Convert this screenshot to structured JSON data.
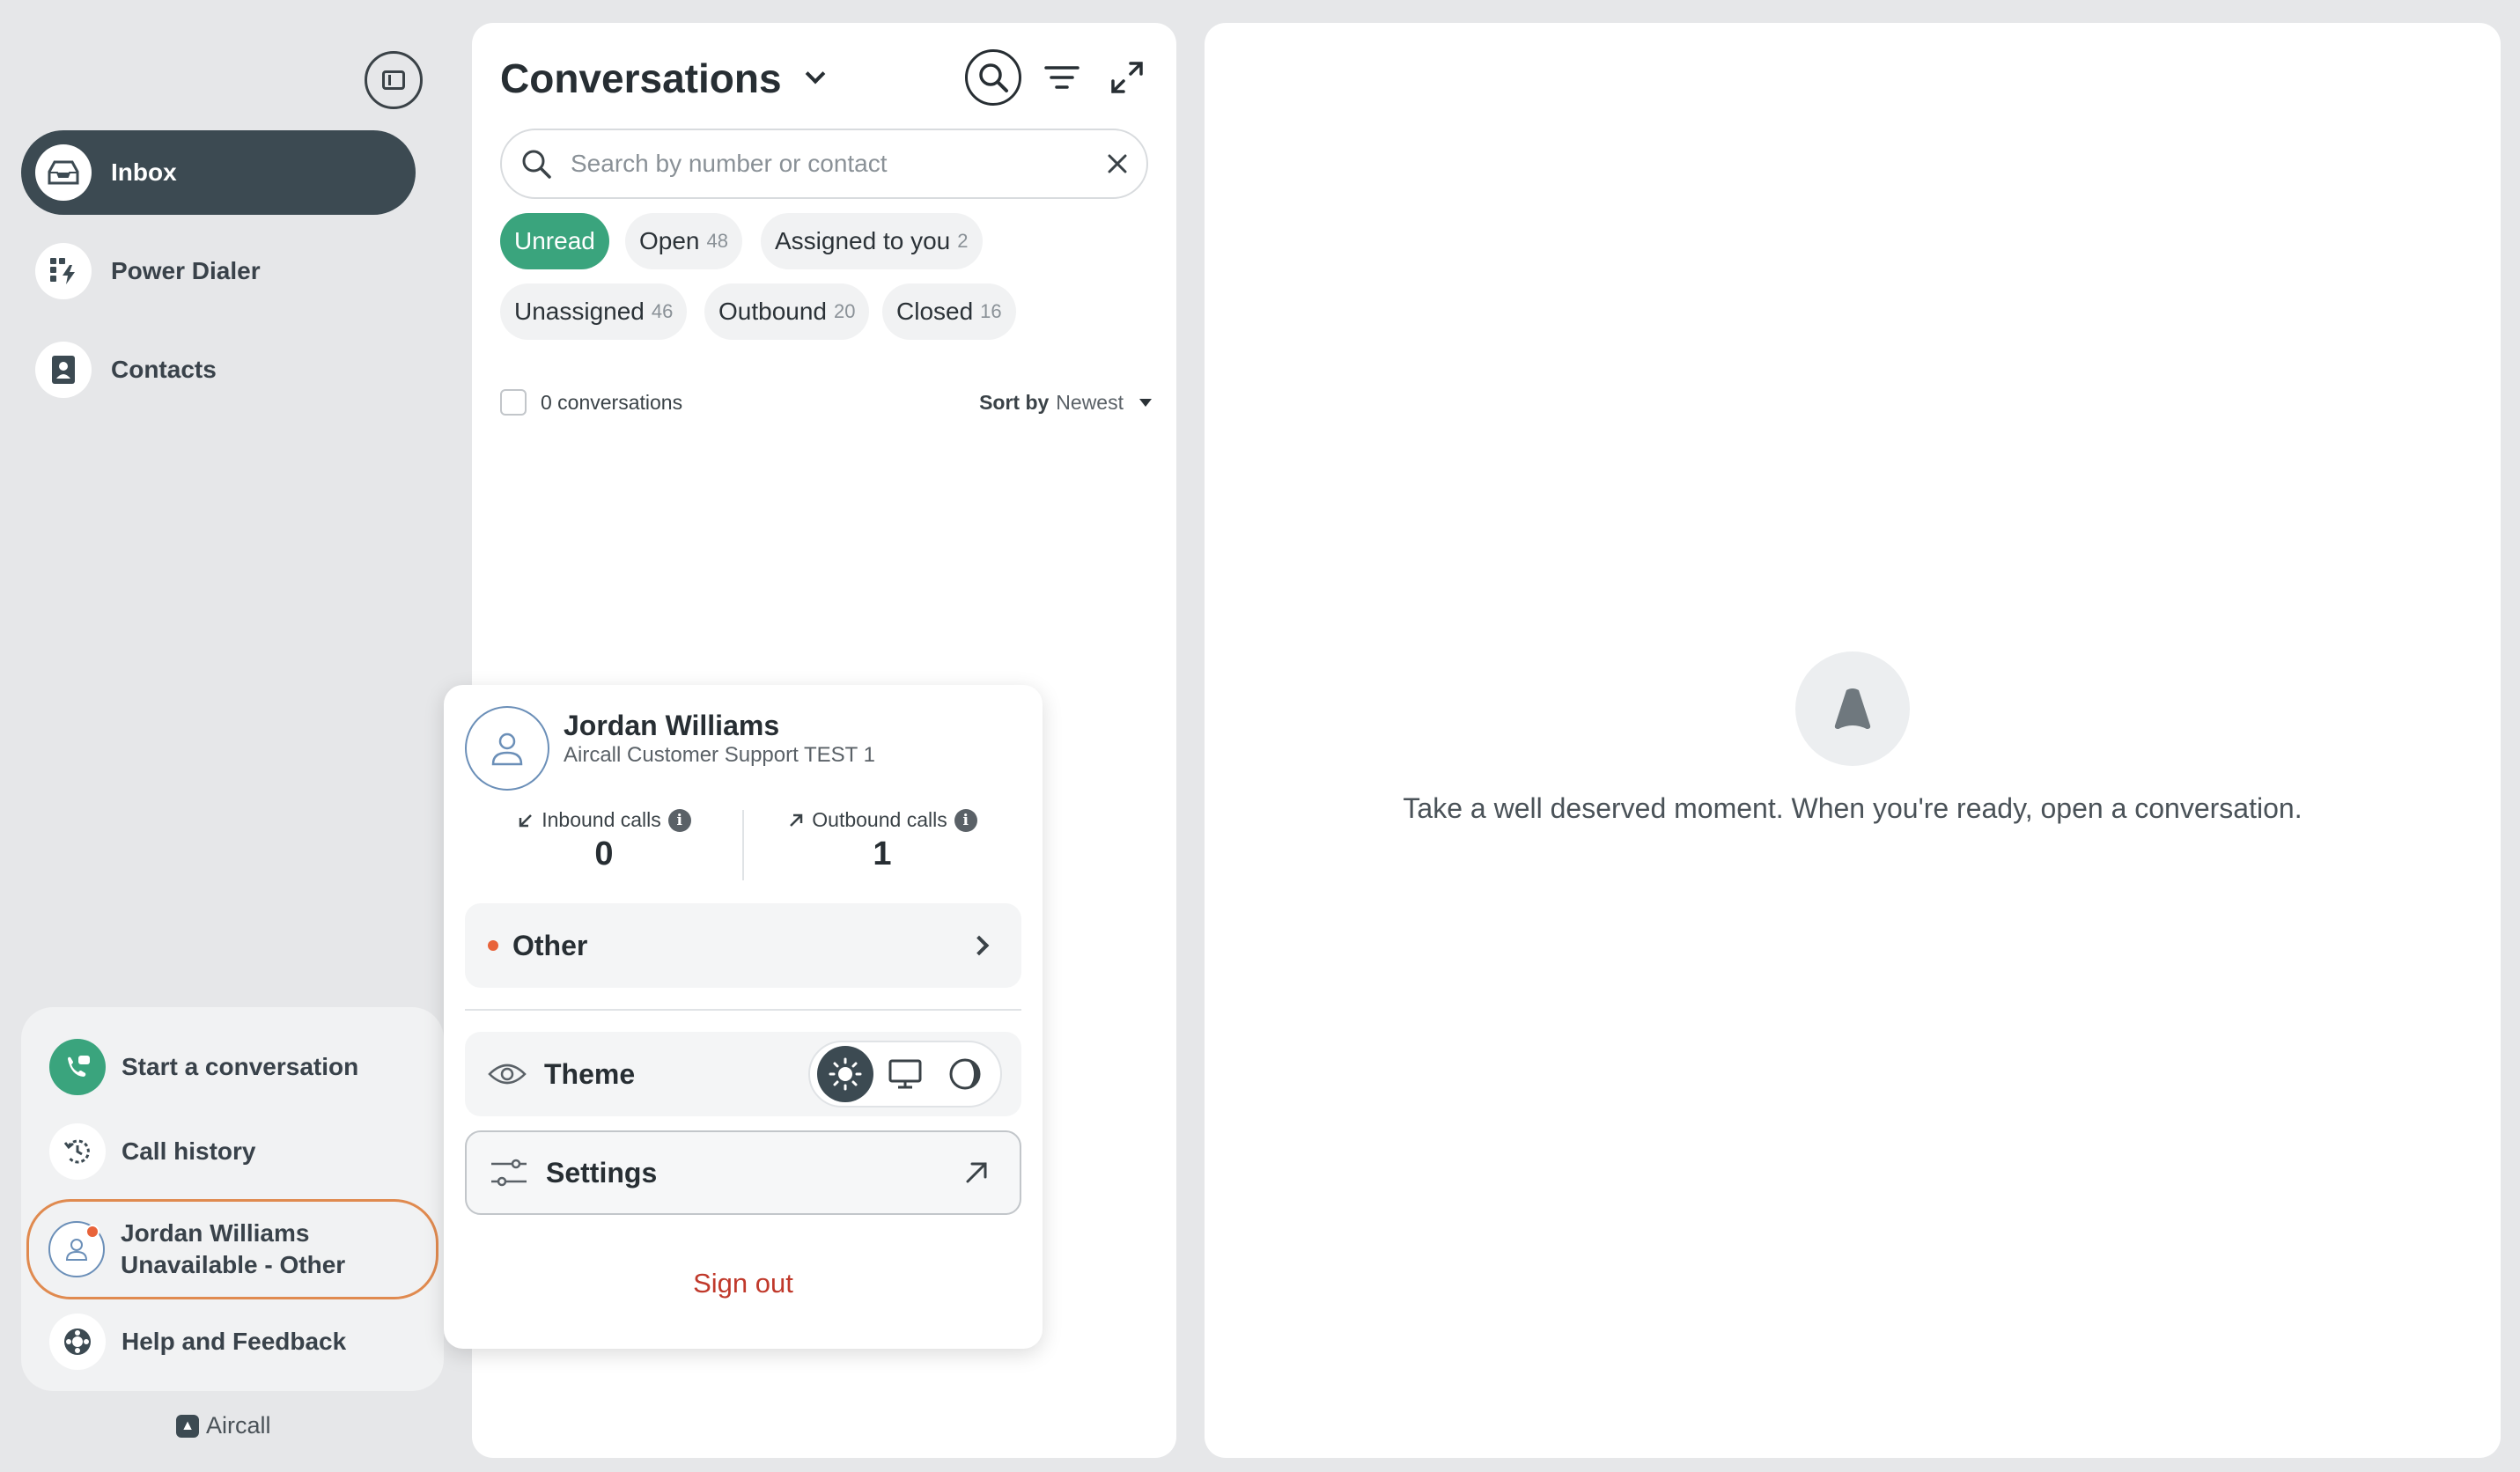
{
  "sidebar": {
    "nav": [
      {
        "label": "Inbox",
        "icon": "inbox-icon",
        "active": true
      },
      {
        "label": "Power Dialer",
        "icon": "power-dialer-icon",
        "active": false
      },
      {
        "label": "Contacts",
        "icon": "contacts-icon",
        "active": false
      }
    ],
    "bottom": {
      "start_conversation": "Start a conversation",
      "call_history": "Call history",
      "user_name": "Jordan Williams",
      "user_status": "Unavailable - Other",
      "help": "Help and Feedback"
    },
    "brand": "Aircall"
  },
  "conversations": {
    "title": "Conversations",
    "search_placeholder": "Search by number or contact",
    "search_value": "",
    "chips": [
      {
        "label": "Unread",
        "count": ""
      },
      {
        "label": "Open",
        "count": "48"
      },
      {
        "label": "Assigned to you",
        "count": "2"
      },
      {
        "label": "Unassigned",
        "count": "46"
      },
      {
        "label": "Outbound",
        "count": "20"
      },
      {
        "label": "Closed",
        "count": "16"
      }
    ],
    "count_label": "0 conversations",
    "sort_label": "Sort by",
    "sort_value": "Newest"
  },
  "detail": {
    "empty_message": "Take a well deserved moment. When you're ready, open a conversation."
  },
  "profile": {
    "name": "Jordan Williams",
    "team": "Aircall Customer Support TEST 1",
    "inbound_label": "Inbound calls",
    "inbound_value": "0",
    "outbound_label": "Outbound calls",
    "outbound_value": "1",
    "status": "Other",
    "theme_label": "Theme",
    "settings_label": "Settings",
    "sign_out": "Sign out"
  },
  "colors": {
    "accent_green": "#3aa47d",
    "nav_active": "#3c4a52",
    "status_red": "#e8633a",
    "status_outline": "#e08a4f",
    "sign_out_red": "#c0392b"
  }
}
